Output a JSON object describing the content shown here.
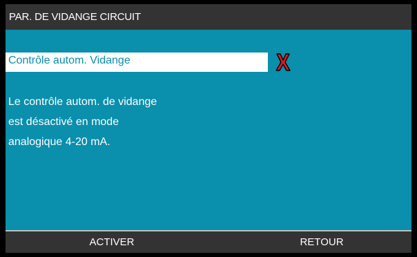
{
  "title_bar": {
    "title": "PAR. DE VIDANGE CIRCUIT"
  },
  "parameter": {
    "label": "Contrôle autom. Vidange",
    "status_icon": "red-x-icon",
    "status_color": "#e3161b"
  },
  "message": {
    "lines": [
      "Le contrôle autom. de vidange",
      "est désactivé en mode",
      "analogique 4-20 mA."
    ]
  },
  "softkeys": {
    "left_label": "ACTIVER",
    "right_label": "RETOUR"
  },
  "colors": {
    "screen_background": "#0a8fac",
    "bar_background": "#333333",
    "frame": "#000000"
  }
}
